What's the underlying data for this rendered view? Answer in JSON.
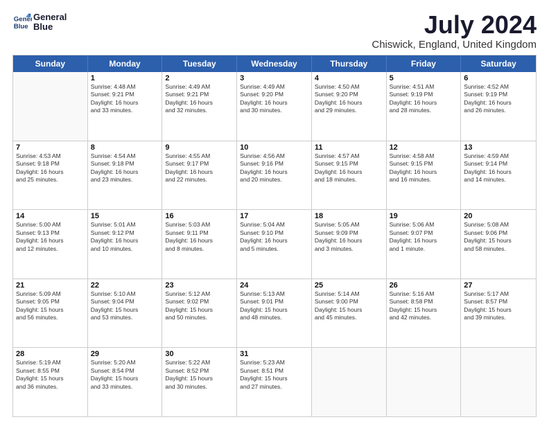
{
  "logo": {
    "line1": "General",
    "line2": "Blue"
  },
  "title": "July 2024",
  "subtitle": "Chiswick, England, United Kingdom",
  "days": [
    "Sunday",
    "Monday",
    "Tuesday",
    "Wednesday",
    "Thursday",
    "Friday",
    "Saturday"
  ],
  "rows": [
    [
      {
        "date": "",
        "info": ""
      },
      {
        "date": "1",
        "info": "Sunrise: 4:48 AM\nSunset: 9:21 PM\nDaylight: 16 hours\nand 33 minutes."
      },
      {
        "date": "2",
        "info": "Sunrise: 4:49 AM\nSunset: 9:21 PM\nDaylight: 16 hours\nand 32 minutes."
      },
      {
        "date": "3",
        "info": "Sunrise: 4:49 AM\nSunset: 9:20 PM\nDaylight: 16 hours\nand 30 minutes."
      },
      {
        "date": "4",
        "info": "Sunrise: 4:50 AM\nSunset: 9:20 PM\nDaylight: 16 hours\nand 29 minutes."
      },
      {
        "date": "5",
        "info": "Sunrise: 4:51 AM\nSunset: 9:19 PM\nDaylight: 16 hours\nand 28 minutes."
      },
      {
        "date": "6",
        "info": "Sunrise: 4:52 AM\nSunset: 9:19 PM\nDaylight: 16 hours\nand 26 minutes."
      }
    ],
    [
      {
        "date": "7",
        "info": "Sunrise: 4:53 AM\nSunset: 9:18 PM\nDaylight: 16 hours\nand 25 minutes."
      },
      {
        "date": "8",
        "info": "Sunrise: 4:54 AM\nSunset: 9:18 PM\nDaylight: 16 hours\nand 23 minutes."
      },
      {
        "date": "9",
        "info": "Sunrise: 4:55 AM\nSunset: 9:17 PM\nDaylight: 16 hours\nand 22 minutes."
      },
      {
        "date": "10",
        "info": "Sunrise: 4:56 AM\nSunset: 9:16 PM\nDaylight: 16 hours\nand 20 minutes."
      },
      {
        "date": "11",
        "info": "Sunrise: 4:57 AM\nSunset: 9:15 PM\nDaylight: 16 hours\nand 18 minutes."
      },
      {
        "date": "12",
        "info": "Sunrise: 4:58 AM\nSunset: 9:15 PM\nDaylight: 16 hours\nand 16 minutes."
      },
      {
        "date": "13",
        "info": "Sunrise: 4:59 AM\nSunset: 9:14 PM\nDaylight: 16 hours\nand 14 minutes."
      }
    ],
    [
      {
        "date": "14",
        "info": "Sunrise: 5:00 AM\nSunset: 9:13 PM\nDaylight: 16 hours\nand 12 minutes."
      },
      {
        "date": "15",
        "info": "Sunrise: 5:01 AM\nSunset: 9:12 PM\nDaylight: 16 hours\nand 10 minutes."
      },
      {
        "date": "16",
        "info": "Sunrise: 5:03 AM\nSunset: 9:11 PM\nDaylight: 16 hours\nand 8 minutes."
      },
      {
        "date": "17",
        "info": "Sunrise: 5:04 AM\nSunset: 9:10 PM\nDaylight: 16 hours\nand 5 minutes."
      },
      {
        "date": "18",
        "info": "Sunrise: 5:05 AM\nSunset: 9:09 PM\nDaylight: 16 hours\nand 3 minutes."
      },
      {
        "date": "19",
        "info": "Sunrise: 5:06 AM\nSunset: 9:07 PM\nDaylight: 16 hours\nand 1 minute."
      },
      {
        "date": "20",
        "info": "Sunrise: 5:08 AM\nSunset: 9:06 PM\nDaylight: 15 hours\nand 58 minutes."
      }
    ],
    [
      {
        "date": "21",
        "info": "Sunrise: 5:09 AM\nSunset: 9:05 PM\nDaylight: 15 hours\nand 56 minutes."
      },
      {
        "date": "22",
        "info": "Sunrise: 5:10 AM\nSunset: 9:04 PM\nDaylight: 15 hours\nand 53 minutes."
      },
      {
        "date": "23",
        "info": "Sunrise: 5:12 AM\nSunset: 9:02 PM\nDaylight: 15 hours\nand 50 minutes."
      },
      {
        "date": "24",
        "info": "Sunrise: 5:13 AM\nSunset: 9:01 PM\nDaylight: 15 hours\nand 48 minutes."
      },
      {
        "date": "25",
        "info": "Sunrise: 5:14 AM\nSunset: 9:00 PM\nDaylight: 15 hours\nand 45 minutes."
      },
      {
        "date": "26",
        "info": "Sunrise: 5:16 AM\nSunset: 8:58 PM\nDaylight: 15 hours\nand 42 minutes."
      },
      {
        "date": "27",
        "info": "Sunrise: 5:17 AM\nSunset: 8:57 PM\nDaylight: 15 hours\nand 39 minutes."
      }
    ],
    [
      {
        "date": "28",
        "info": "Sunrise: 5:19 AM\nSunset: 8:55 PM\nDaylight: 15 hours\nand 36 minutes."
      },
      {
        "date": "29",
        "info": "Sunrise: 5:20 AM\nSunset: 8:54 PM\nDaylight: 15 hours\nand 33 minutes."
      },
      {
        "date": "30",
        "info": "Sunrise: 5:22 AM\nSunset: 8:52 PM\nDaylight: 15 hours\nand 30 minutes."
      },
      {
        "date": "31",
        "info": "Sunrise: 5:23 AM\nSunset: 8:51 PM\nDaylight: 15 hours\nand 27 minutes."
      },
      {
        "date": "",
        "info": ""
      },
      {
        "date": "",
        "info": ""
      },
      {
        "date": "",
        "info": ""
      }
    ]
  ]
}
